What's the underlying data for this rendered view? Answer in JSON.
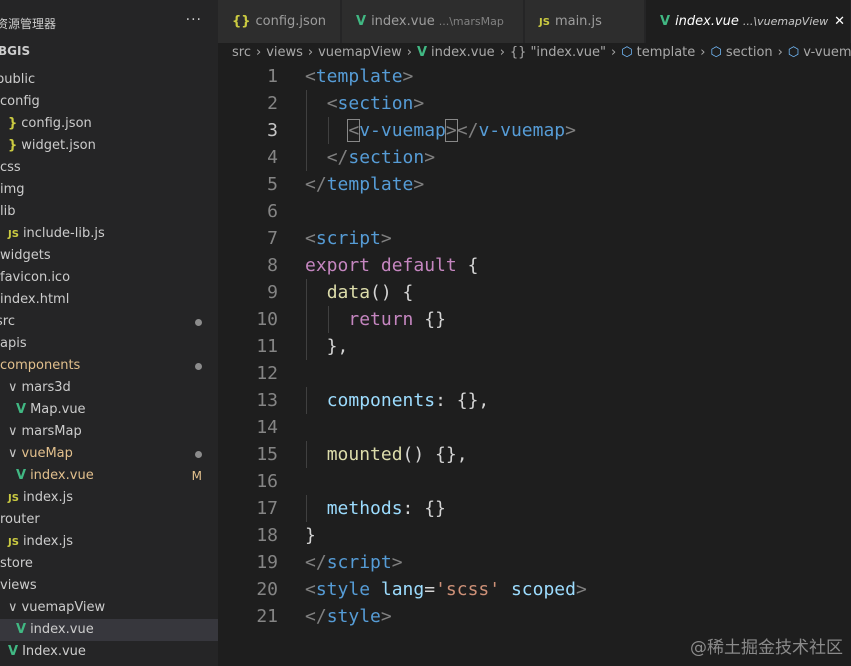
{
  "sidebar": {
    "title": "资源管理器",
    "project": "BGIS",
    "more": "···",
    "items": [
      {
        "label": "public",
        "icon": "folder",
        "indent": 0
      },
      {
        "label": "config",
        "icon": "folder",
        "indent": 1
      },
      {
        "label": "config.json",
        "icon": "json",
        "indent": 2
      },
      {
        "label": "widget.json",
        "icon": "json",
        "indent": 2
      },
      {
        "label": "css",
        "icon": "folder",
        "indent": 1
      },
      {
        "label": "img",
        "icon": "folder",
        "indent": 1
      },
      {
        "label": "lib",
        "icon": "folder",
        "indent": 1
      },
      {
        "label": "include-lib.js",
        "icon": "js",
        "indent": 2
      },
      {
        "label": "widgets",
        "icon": "folder",
        "indent": 1
      },
      {
        "label": "favicon.ico",
        "icon": "file",
        "indent": 1
      },
      {
        "label": "index.html",
        "icon": "file",
        "indent": 1
      },
      {
        "label": "src",
        "icon": "folder",
        "indent": 0,
        "dot": true
      },
      {
        "label": "apis",
        "icon": "folder",
        "indent": 1
      },
      {
        "label": "components",
        "icon": "folder",
        "indent": 1,
        "dot": true,
        "modified": true
      },
      {
        "label": "mars3d",
        "icon": "folder-open",
        "indent": 2
      },
      {
        "label": "Map.vue",
        "icon": "vue",
        "indent": 3
      },
      {
        "label": "marsMap",
        "icon": "folder-open",
        "indent": 2
      },
      {
        "label": "vueMap",
        "icon": "folder-open",
        "indent": 2,
        "dot": true,
        "modified": true
      },
      {
        "label": "index.vue",
        "icon": "vue",
        "indent": 3,
        "badge": "M",
        "modified": true
      },
      {
        "label": "index.js",
        "icon": "js",
        "indent": 2
      },
      {
        "label": "router",
        "icon": "folder",
        "indent": 1
      },
      {
        "label": "index.js",
        "icon": "js",
        "indent": 2
      },
      {
        "label": "store",
        "icon": "folder",
        "indent": 1
      },
      {
        "label": "views",
        "icon": "folder",
        "indent": 1
      },
      {
        "label": "vuemapView",
        "icon": "folder-open",
        "indent": 2
      },
      {
        "label": "index.vue",
        "icon": "vue",
        "indent": 3,
        "selected": true
      },
      {
        "label": "Index.vue",
        "icon": "vue",
        "indent": 2
      }
    ]
  },
  "tabs": [
    {
      "label": "config.json",
      "icon": "json",
      "desc": ""
    },
    {
      "label": "index.vue",
      "icon": "vue",
      "desc": "...\\marsMap"
    },
    {
      "label": "main.js",
      "icon": "js",
      "desc": ""
    },
    {
      "label": "index.vue",
      "icon": "vue",
      "desc": "...\\vuemapView",
      "active": true,
      "close": "✕"
    }
  ],
  "breadcrumb": [
    {
      "label": "src"
    },
    {
      "label": "views"
    },
    {
      "label": "vuemapView"
    },
    {
      "label": "index.vue",
      "icon": "vue"
    },
    {
      "label": "\"index.vue\"",
      "icon": "braces"
    },
    {
      "label": "template",
      "icon": "cube"
    },
    {
      "label": "section",
      "icon": "cube"
    },
    {
      "label": "v-vuemap",
      "icon": "cube"
    }
  ],
  "editor": {
    "current_line": 3,
    "lines": [
      {
        "n": "1",
        "guides": 0,
        "tokens": [
          [
            "punc",
            "<"
          ],
          [
            "tag",
            "template"
          ],
          [
            "punc",
            ">"
          ]
        ]
      },
      {
        "n": "2",
        "guides": 1,
        "tokens": [
          [
            "plain",
            "  "
          ],
          [
            "punc",
            "<"
          ],
          [
            "tag",
            "section"
          ],
          [
            "punc",
            ">"
          ]
        ]
      },
      {
        "n": "3",
        "guides": 2,
        "tokens": [
          [
            "plain",
            "    "
          ],
          [
            "punc",
            "<"
          ],
          [
            "tag",
            "v-vuemap"
          ],
          [
            "punc",
            ">"
          ],
          [
            "punc",
            "</"
          ],
          [
            "tag",
            "v-vuemap"
          ],
          [
            "punc",
            ">"
          ]
        ]
      },
      {
        "n": "4",
        "guides": 1,
        "tokens": [
          [
            "plain",
            "  "
          ],
          [
            "punc",
            "</"
          ],
          [
            "tag",
            "section"
          ],
          [
            "punc",
            ">"
          ]
        ]
      },
      {
        "n": "5",
        "guides": 0,
        "tokens": [
          [
            "punc",
            "</"
          ],
          [
            "tag",
            "template"
          ],
          [
            "punc",
            ">"
          ]
        ]
      },
      {
        "n": "6",
        "guides": 0,
        "tokens": []
      },
      {
        "n": "7",
        "guides": 0,
        "tokens": [
          [
            "punc",
            "<"
          ],
          [
            "tag",
            "script"
          ],
          [
            "punc",
            ">"
          ]
        ]
      },
      {
        "n": "8",
        "guides": 0,
        "tokens": [
          [
            "kw",
            "export"
          ],
          [
            "plain",
            " "
          ],
          [
            "kw",
            "default"
          ],
          [
            "plain",
            " {"
          ]
        ]
      },
      {
        "n": "9",
        "guides": 1,
        "tokens": [
          [
            "plain",
            "  "
          ],
          [
            "fn",
            "data"
          ],
          [
            "plain",
            "() {"
          ]
        ]
      },
      {
        "n": "10",
        "guides": 2,
        "tokens": [
          [
            "plain",
            "    "
          ],
          [
            "kw",
            "return"
          ],
          [
            "plain",
            " {}"
          ]
        ]
      },
      {
        "n": "11",
        "guides": 1,
        "tokens": [
          [
            "plain",
            "  },"
          ]
        ]
      },
      {
        "n": "12",
        "guides": 0,
        "tokens": []
      },
      {
        "n": "13",
        "guides": 1,
        "tokens": [
          [
            "plain",
            "  "
          ],
          [
            "prop",
            "components"
          ],
          [
            "plain",
            ": {},"
          ]
        ]
      },
      {
        "n": "14",
        "guides": 0,
        "tokens": []
      },
      {
        "n": "15",
        "guides": 1,
        "tokens": [
          [
            "plain",
            "  "
          ],
          [
            "fn",
            "mounted"
          ],
          [
            "plain",
            "() {},"
          ]
        ]
      },
      {
        "n": "16",
        "guides": 0,
        "tokens": []
      },
      {
        "n": "17",
        "guides": 1,
        "tokens": [
          [
            "plain",
            "  "
          ],
          [
            "prop",
            "methods"
          ],
          [
            "plain",
            ": {}"
          ]
        ]
      },
      {
        "n": "18",
        "guides": 0,
        "tokens": [
          [
            "plain",
            "}"
          ]
        ]
      },
      {
        "n": "19",
        "guides": 0,
        "tokens": [
          [
            "punc",
            "</"
          ],
          [
            "tag",
            "script"
          ],
          [
            "punc",
            ">"
          ]
        ]
      },
      {
        "n": "20",
        "guides": 0,
        "tokens": [
          [
            "punc",
            "<"
          ],
          [
            "tag",
            "style"
          ],
          [
            "plain",
            " "
          ],
          [
            "prop",
            "lang"
          ],
          [
            "plain",
            "="
          ],
          [
            "str",
            "'scss'"
          ],
          [
            "plain",
            " "
          ],
          [
            "prop",
            "scoped"
          ],
          [
            "punc",
            ">"
          ]
        ]
      },
      {
        "n": "21",
        "guides": 0,
        "tokens": [
          [
            "punc",
            "</"
          ],
          [
            "tag",
            "style"
          ],
          [
            "punc",
            ">"
          ]
        ]
      }
    ]
  },
  "watermark": "@稀土掘金技术社区",
  "colors": {
    "background": "#1e1e1e",
    "sidebar": "#252526",
    "tag": "#569cd6",
    "keyword": "#c586c0",
    "function": "#dcdcaa",
    "property": "#9cdcfe",
    "string": "#ce9178",
    "vue_icon": "#41b883",
    "modified": "#e2c08d"
  }
}
